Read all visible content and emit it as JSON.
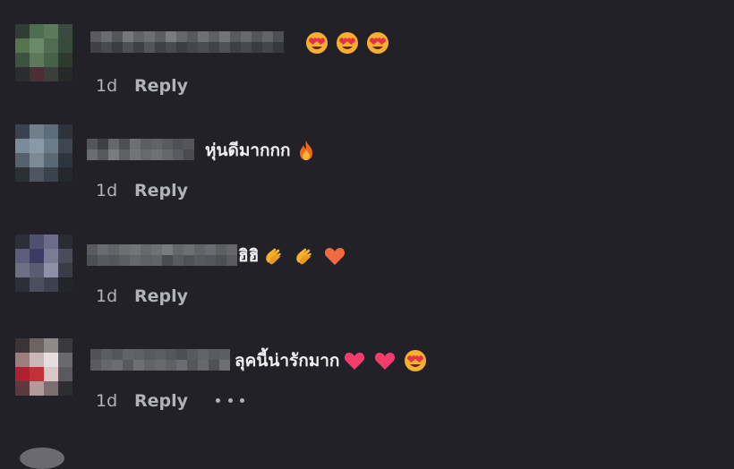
{
  "comments": [
    {
      "text": "",
      "emojis": [
        "heart-eyes",
        "heart-eyes",
        "heart-eyes"
      ],
      "time": "1d",
      "reply_label": "Reply"
    },
    {
      "text": "หุ่นดีมากกก",
      "emojis": [
        "fire"
      ],
      "time": "1d",
      "reply_label": "Reply"
    },
    {
      "text": "ฮิฮิ",
      "emojis": [
        "clap",
        "clap",
        "orange-heart"
      ],
      "time": "1d",
      "reply_label": "Reply"
    },
    {
      "text": "ลุคนี้น่ารักมาก",
      "emojis": [
        "pink-heart",
        "pink-heart",
        "heart-eyes"
      ],
      "time": "1d",
      "reply_label": "Reply"
    }
  ],
  "more_options_icon": "more-options-icon",
  "colors": {
    "background": "#222127",
    "text": "#f0f0f2",
    "meta": "#b0b3b8"
  }
}
